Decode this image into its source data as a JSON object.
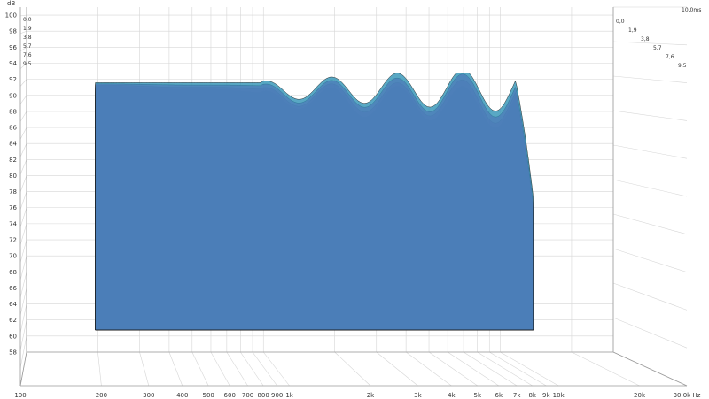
{
  "chart_data": {
    "type": "waterfall",
    "ylabel": "dB",
    "xunit": "Hz",
    "zunit": "ms",
    "y_ticks": [
      58,
      60,
      62,
      64,
      66,
      68,
      70,
      72,
      74,
      76,
      78,
      80,
      82,
      84,
      86,
      88,
      90,
      92,
      94,
      96,
      98,
      100
    ],
    "ylim": [
      58,
      101
    ],
    "x_ticks": [
      {
        "freq": 100,
        "label": "100"
      },
      {
        "freq": 200,
        "label": "200"
      },
      {
        "freq": 300,
        "label": "300"
      },
      {
        "freq": 400,
        "label": "400"
      },
      {
        "freq": 500,
        "label": "500"
      },
      {
        "freq": 600,
        "label": "600"
      },
      {
        "freq": 700,
        "label": "700"
      },
      {
        "freq": 800,
        "label": "800"
      },
      {
        "freq": 900,
        "label": "900"
      },
      {
        "freq": 1000,
        "label": "1k"
      },
      {
        "freq": 2000,
        "label": "2k"
      },
      {
        "freq": 3000,
        "label": "3k"
      },
      {
        "freq": 4000,
        "label": "4k"
      },
      {
        "freq": 5000,
        "label": "5k"
      },
      {
        "freq": 6000,
        "label": "6k"
      },
      {
        "freq": 7000,
        "label": "7k"
      },
      {
        "freq": 8000,
        "label": "8k"
      },
      {
        "freq": 9000,
        "label": "9k"
      },
      {
        "freq": 10000,
        "label": "10k"
      },
      {
        "freq": 20000,
        "label": "20k"
      },
      {
        "freq": 30000,
        "label": "30,0k Hz"
      }
    ],
    "xlim": [
      100,
      30000
    ],
    "time_ticks": [
      "0,0",
      "1,9",
      "3,8",
      "5,7",
      "7,6",
      "9,5"
    ],
    "time_max_label": "10,0ms",
    "time_range_ms": [
      0,
      10
    ],
    "freq_range_hz": [
      190,
      15000
    ],
    "peak_level_db": 92,
    "floor_level_db": 61,
    "colors": {
      "magenta": "#c43ccb",
      "cyan": "#2a8fb3",
      "background": "#ffffff"
    }
  }
}
